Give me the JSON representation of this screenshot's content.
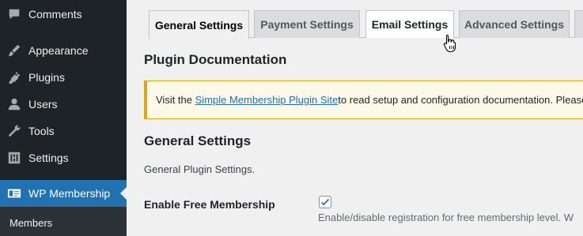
{
  "sidebar": {
    "items": [
      {
        "label": "Comments",
        "icon": "comments-icon"
      },
      {
        "label": "Appearance",
        "icon": "appearance-brush-icon"
      },
      {
        "label": "Plugins",
        "icon": "plugins-icon"
      },
      {
        "label": "Users",
        "icon": "users-icon"
      },
      {
        "label": "Tools",
        "icon": "tools-wrench-icon"
      },
      {
        "label": "Settings",
        "icon": "settings-sliders-icon"
      },
      {
        "label": "WP Membership",
        "icon": "membership-id-card-icon",
        "current": true
      }
    ],
    "submenu": {
      "label": "Members"
    }
  },
  "tabs": [
    {
      "label": "General Settings",
      "state": "active"
    },
    {
      "label": "Payment Settings",
      "state": "inactive"
    },
    {
      "label": "Email Settings",
      "state": "hover"
    },
    {
      "label": "Advanced Settings",
      "state": "inactive"
    }
  ],
  "documentation": {
    "heading": "Plugin Documentation",
    "notice_prefix": "Visit the ",
    "notice_link": "Simple Membership Plugin Site",
    "notice_suffix": " to read setup and configuration documentation. Please"
  },
  "general": {
    "heading": "General Settings",
    "description": "General Plugin Settings."
  },
  "free_membership": {
    "label": "Enable Free Membership",
    "checked": true,
    "help": "Enable/disable registration for free membership level. W"
  },
  "colors": {
    "sidebar_bg": "#1d2327",
    "accent": "#2271b1",
    "notice_border": "#dba617",
    "notice_bg": "#fcf9e8"
  }
}
